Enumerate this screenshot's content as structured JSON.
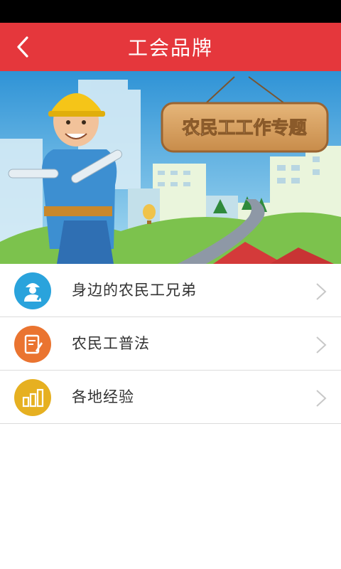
{
  "header": {
    "title": "工会品牌",
    "bar_color": "#e5373c",
    "back_icon": "chevron-left-icon"
  },
  "banner": {
    "sign_text": "农民工工作专题",
    "sky_color": "#3aa0dc"
  },
  "menu": {
    "items": [
      {
        "label": "身边的农民工兄弟",
        "icon": "worker-icon",
        "color": "#2aa3dc"
      },
      {
        "label": "农民工普法",
        "icon": "notebook-icon",
        "color": "#ea7430"
      },
      {
        "label": "各地经验",
        "icon": "bar-chart-icon",
        "color": "#e6b021"
      }
    ]
  }
}
